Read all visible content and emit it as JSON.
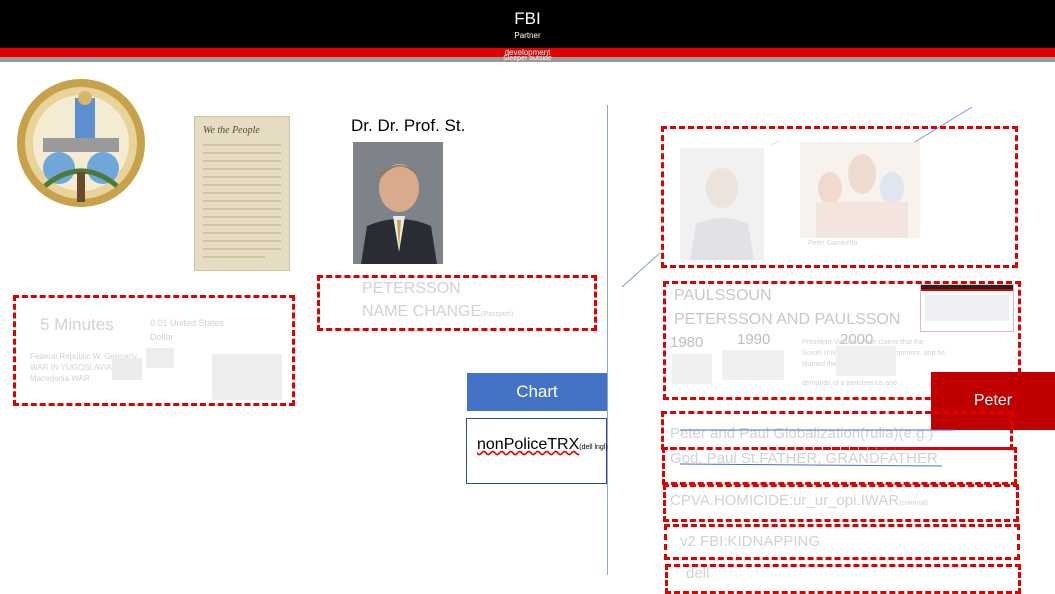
{
  "header": {
    "title": "FBI",
    "subtitle": "Partner",
    "dev_line_1": "development",
    "dev_line_2": "Sleeper outside"
  },
  "left": {
    "person_title": "Dr. Dr. Prof. St.",
    "box1": {
      "big": "5 Minutes",
      "amount": "0.01 United States",
      "currency": "Dollar",
      "caption1": "Federal Republic W. Germany",
      "caption2": "WAR IN YUGOSLAVIA",
      "caption3": "Macedonia WAR"
    },
    "box2": {
      "line1": "PETERSSON",
      "line2": "NAME CHANGE",
      "line2_sub": "(Passport)"
    }
  },
  "center": {
    "chart_button": "Chart",
    "ptrx_label": "nonPoliceTRX",
    "ptrx_sub": "(dell lngl)"
  },
  "right": {
    "box_a_caption": "Peter Gambetta",
    "paulssoun": "PAULSSOUN",
    "petersson_paulsson": "PETERSSON AND PAULSSON",
    "years": [
      "1980",
      "1990",
      "2000"
    ],
    "bio_text_1": "President Vladimir Putin claims that the",
    "bio_text_2": "Soviet Union fell in one tragic moment, and he",
    "bio_text_3": "blamed the breakup of the",
    "bio_text_4": "demands of a treacherous and",
    "peter_button": "Peter",
    "row1": "Peter and Paul Globalization(rulia)(e.g.)",
    "row2": "God, Paul St.FATHER, GRANDFATHER",
    "row3": "CPVA.HOMICIDE:ur_ur_opi.IWAR",
    "row3_sub": "(criminal)",
    "row4": "v2 FBI:KIDNAPPING",
    "row5": "dell"
  },
  "colors": {
    "header_bg": "#000000",
    "accent_red": "#e00000",
    "chart_blue": "#4472c4",
    "peter_red": "#c00000"
  }
}
